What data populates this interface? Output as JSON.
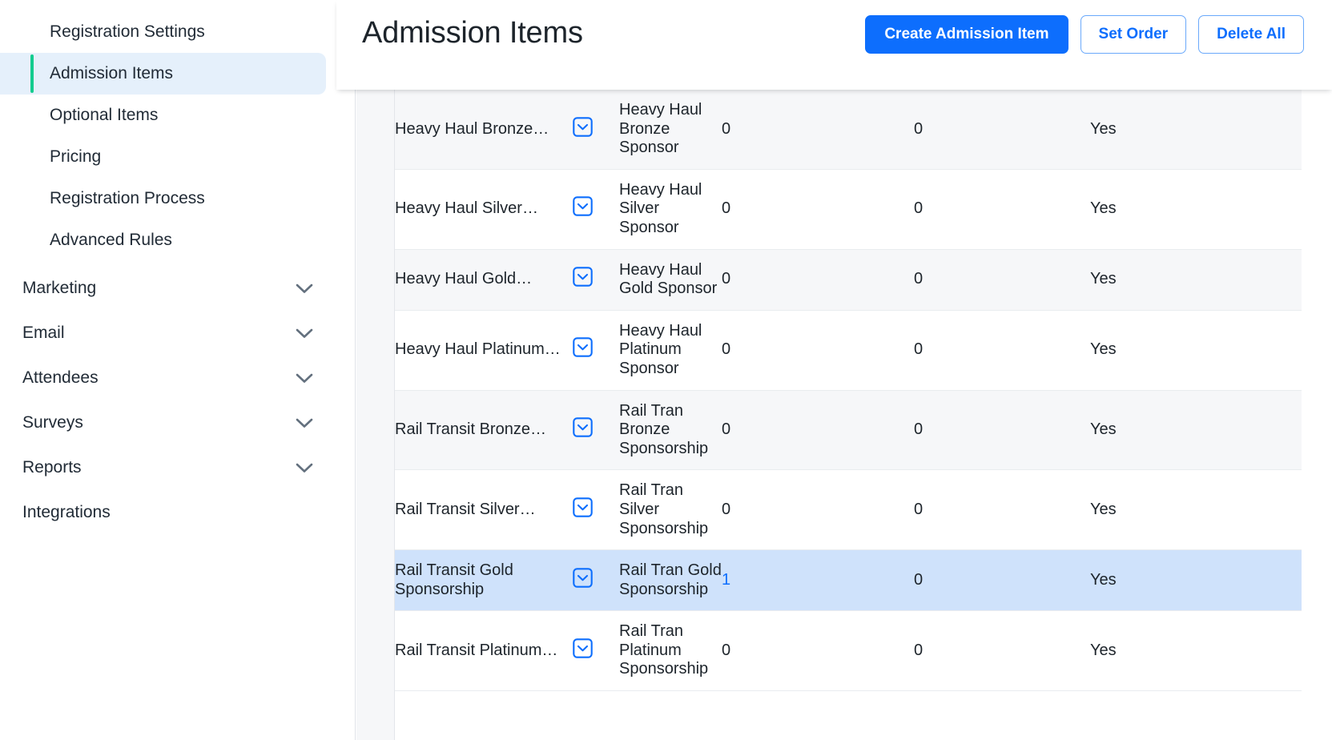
{
  "sidebar": {
    "sub_items": [
      {
        "label": "Registration Settings",
        "active": false
      },
      {
        "label": "Admission Items",
        "active": true
      },
      {
        "label": "Optional Items",
        "active": false
      },
      {
        "label": "Pricing",
        "active": false
      },
      {
        "label": "Registration Process",
        "active": false
      },
      {
        "label": "Advanced Rules",
        "active": false
      }
    ],
    "top_items": [
      {
        "label": "Marketing",
        "expandable": true
      },
      {
        "label": "Email",
        "expandable": true
      },
      {
        "label": "Attendees",
        "expandable": true
      },
      {
        "label": "Surveys",
        "expandable": true
      },
      {
        "label": "Reports",
        "expandable": true
      },
      {
        "label": "Integrations",
        "expandable": false
      }
    ]
  },
  "header": {
    "title": "Admission Items",
    "buttons": {
      "create": "Create Admission Item",
      "set_order": "Set Order",
      "delete_all": "Delete All"
    }
  },
  "colors": {
    "accent_blue": "#0d6efd",
    "active_green": "#14cc8f",
    "selected_row": "#cfe2fb",
    "stripe": "#f6f7f9"
  },
  "table": {
    "rows": [
      {
        "name": "Heavy Haul Bronze…",
        "checkbox": "chevron-down-box",
        "description": "Heavy Haul Bronze Sponsor",
        "qty1": "0",
        "qty1_link": false,
        "qty2": "0",
        "active": "Yes",
        "stripe": true,
        "selected": false
      },
      {
        "name": "Heavy Haul Silver…",
        "checkbox": "chevron-down-box",
        "description": "Heavy Haul Silver Sponsor",
        "qty1": "0",
        "qty1_link": false,
        "qty2": "0",
        "active": "Yes",
        "stripe": false,
        "selected": false
      },
      {
        "name": "Heavy Haul Gold…",
        "checkbox": "chevron-down-box",
        "description": "Heavy Haul Gold Sponsor",
        "qty1": "0",
        "qty1_link": false,
        "qty2": "0",
        "active": "Yes",
        "stripe": true,
        "selected": false
      },
      {
        "name": "Heavy Haul Platinum…",
        "checkbox": "chevron-down-box",
        "description": "Heavy Haul Platinum Sponsor",
        "qty1": "0",
        "qty1_link": false,
        "qty2": "0",
        "active": "Yes",
        "stripe": false,
        "selected": false
      },
      {
        "name": "Rail Transit Bronze…",
        "checkbox": "chevron-down-box",
        "description": "Rail Tran Bronze Sponsorship",
        "qty1": "0",
        "qty1_link": false,
        "qty2": "0",
        "active": "Yes",
        "stripe": true,
        "selected": false
      },
      {
        "name": "Rail Transit Silver…",
        "checkbox": "chevron-down-box",
        "description": "Rail Tran Silver Sponsorship",
        "qty1": "0",
        "qty1_link": false,
        "qty2": "0",
        "active": "Yes",
        "stripe": false,
        "selected": false
      },
      {
        "name": "Rail Transit Gold Sponsorship",
        "checkbox": "chevron-down-box",
        "description": "Rail Tran Gold Sponsorship",
        "qty1": "1",
        "qty1_link": true,
        "qty2": "0",
        "active": "Yes",
        "stripe": false,
        "selected": true
      },
      {
        "name": "Rail Transit Platinum…",
        "checkbox": "chevron-down-box",
        "description": "Rail Tran Platinum Sponsorship",
        "qty1": "0",
        "qty1_link": false,
        "qty2": "0",
        "active": "Yes",
        "stripe": false,
        "selected": false
      }
    ]
  }
}
